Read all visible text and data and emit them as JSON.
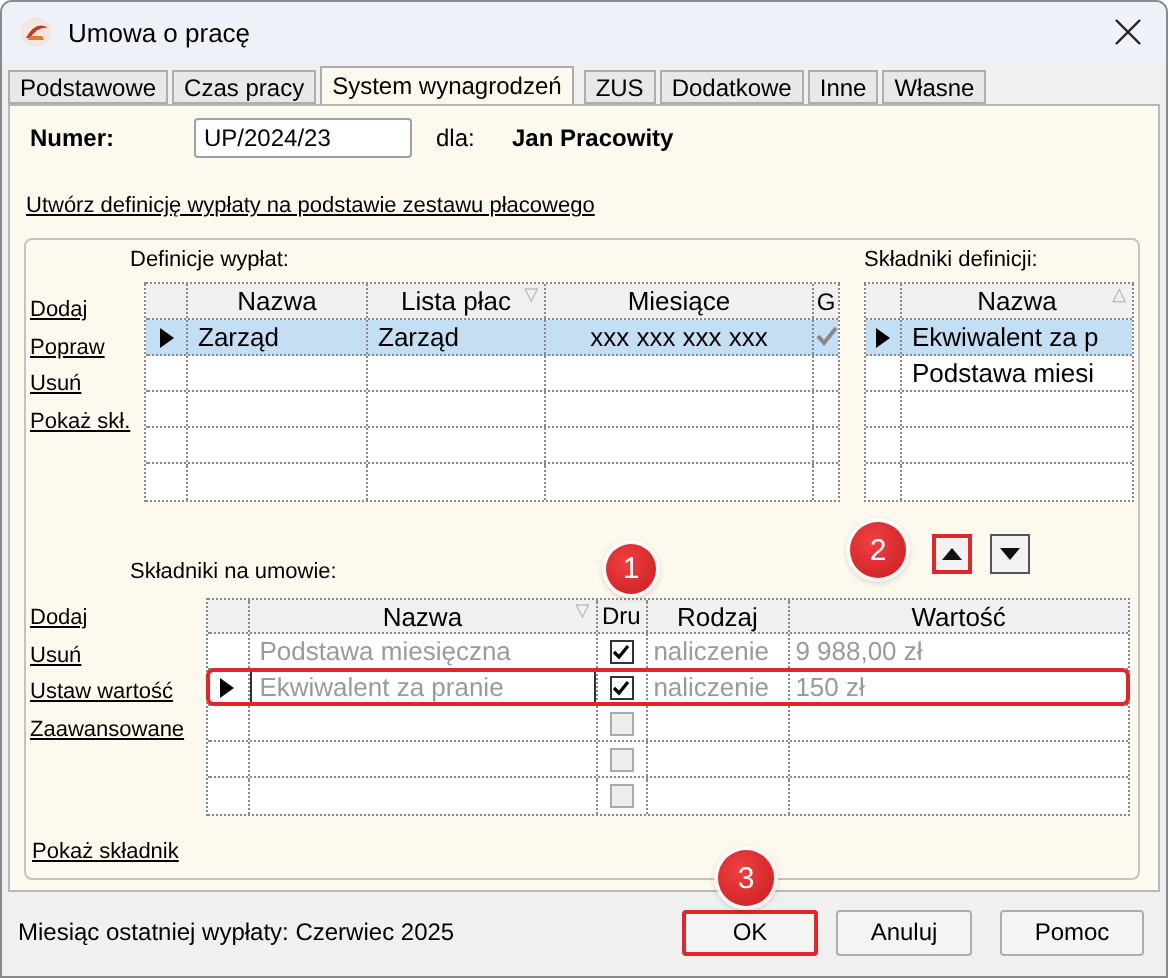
{
  "window": {
    "title": "Umowa o pracę"
  },
  "tabs": [
    {
      "label": "Podstawowe",
      "selected": false
    },
    {
      "label": "Czas pracy",
      "selected": false
    },
    {
      "label": "System wynagrodzeń",
      "selected": true
    },
    {
      "label": "ZUS",
      "selected": false
    },
    {
      "label": "Dodatkowe",
      "selected": false
    },
    {
      "label": "Inne",
      "selected": false
    },
    {
      "label": "Własne",
      "selected": false
    }
  ],
  "number": {
    "label": "Numer:",
    "value": "UP/2024/23"
  },
  "employee": {
    "label": "dla:",
    "name": "Jan Pracowity"
  },
  "template_link": "Utwórz definicję wypłaty na podstawie zestawu płacowego",
  "definitions": {
    "label": "Definicje wypłat:",
    "actions": [
      "Dodaj",
      "Popraw",
      "Usuń",
      "Pokaż skł."
    ],
    "columns": [
      {
        "label": "Nazwa"
      },
      {
        "label": "Lista płac",
        "sort_mark": "▽"
      },
      {
        "label": "Miesiące"
      },
      {
        "label": "G"
      }
    ],
    "rows": [
      {
        "selected": true,
        "name": "Zarząd",
        "payroll": "Zarząd",
        "months": "xxx xxx xxx xxx",
        "g": true
      }
    ]
  },
  "definition_components": {
    "label": "Składniki definicji:",
    "columns": [
      {
        "label": "Nazwa",
        "sort_mark": "△"
      }
    ],
    "rows": [
      {
        "selected": true,
        "name": "Ekwiwalent za p"
      },
      {
        "selected": false,
        "name": "Podstawa miesi"
      }
    ]
  },
  "move_buttons": [
    {
      "kind": "up",
      "highlighted": true
    },
    {
      "kind": "down",
      "highlighted": false
    }
  ],
  "contract_components": {
    "label": "Składniki na umowie:",
    "actions": [
      "Dodaj",
      "Usuń",
      "Ustaw wartość",
      "Zaawansowane"
    ],
    "columns": [
      {
        "label": "Nazwa",
        "sort_mark": "▽"
      },
      {
        "label": "Dru"
      },
      {
        "label": "Rodzaj"
      },
      {
        "label": "Wartość"
      }
    ],
    "rows": [
      {
        "selected": false,
        "highlighted": false,
        "name": "Podstawa miesięczna",
        "checked": true,
        "type": "naliczenie",
        "value": "9 988,00 zł"
      },
      {
        "selected": true,
        "highlighted": true,
        "name": "Ekwiwalent za pranie",
        "checked": true,
        "type": "naliczenie",
        "value": "150 zł"
      },
      {
        "selected": false,
        "highlighted": false,
        "checked": false
      },
      {
        "selected": false,
        "highlighted": false,
        "checked": false
      },
      {
        "selected": false,
        "highlighted": false,
        "checked": false
      }
    ]
  },
  "show_component_link": "Pokaż składnik",
  "status": "Miesiąc ostatniej wypłaty: Czerwiec 2025",
  "buttons": [
    {
      "label": "OK",
      "highlighted": true
    },
    {
      "label": "Anuluj",
      "highlighted": false
    },
    {
      "label": "Pomoc",
      "highlighted": false
    }
  ],
  "callouts": [
    {
      "number": "1"
    },
    {
      "number": "2"
    },
    {
      "number": "3"
    }
  ]
}
